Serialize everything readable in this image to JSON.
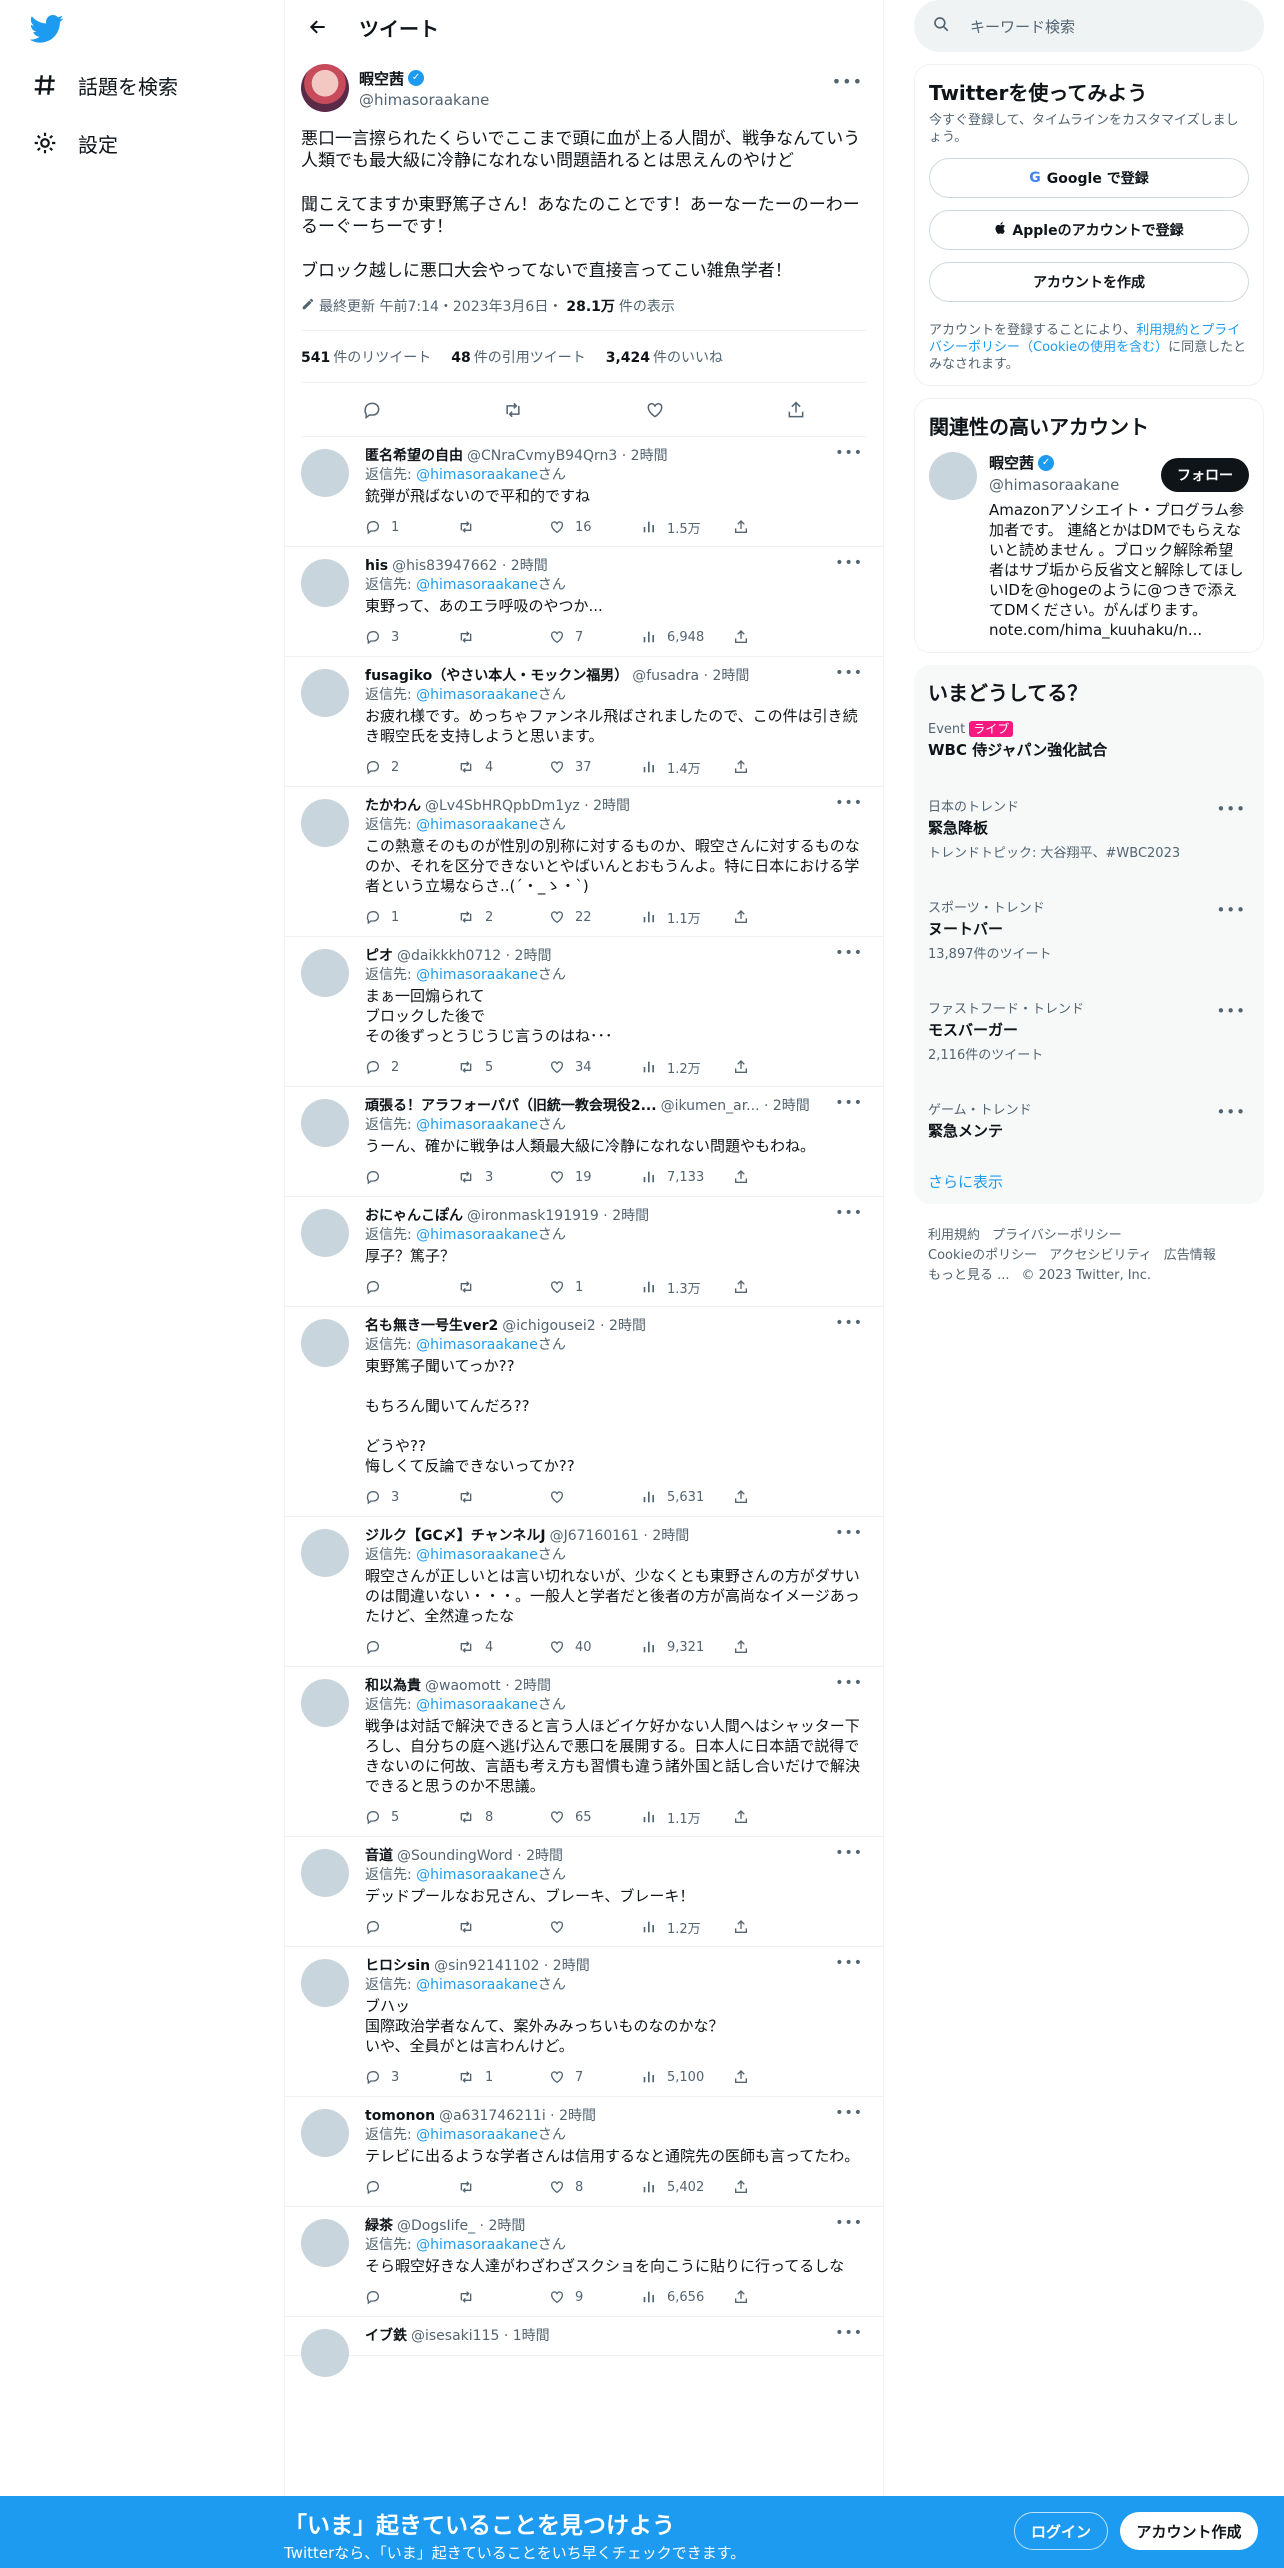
{
  "nav": {
    "explore_label": "話題を検索",
    "settings_label": "設定"
  },
  "header": {
    "title": "ツイート"
  },
  "main_tweet": {
    "name": "暇空茜",
    "handle": "@himasoraakane",
    "text": "悪口一言擦られたくらいでここまで頭に血が上る人間が、戦争なんていう人類でも最大級に冷静になれない問題語れるとは思えんのやけど\n\n聞こえてますか東野篤子さん！あなたのことです！あーなーたーのーわーるーぐーちーです！\n\nブロック越しに悪口大会やってないで直接言ってこい雑魚学者！",
    "edited": "最終更新 午前7:14・2023年3月6日・",
    "views": "28.1万",
    "views_label": "件の表示",
    "retweets": "541",
    "retweets_label": "件のリツイート",
    "quotes": "48",
    "quotes_label": "件の引用ツイート",
    "likes": "3,424",
    "likes_label": "件のいいね"
  },
  "reply_prefix": "返信先: ",
  "reply_to": "@himasoraakane",
  "reply_suffix": "さん",
  "replies": [
    {
      "name": "匿名希望の自由",
      "handle": "@CNraCvmyB94Qrn3",
      "time": "2時間",
      "text": "銃弾が飛ばないので平和的ですね",
      "replies": "1",
      "retweets": "",
      "likes": "16",
      "views": "1.5万"
    },
    {
      "name": "his",
      "handle": "@his83947662",
      "time": "2時間",
      "text": "東野って、あのエラ呼吸のやつか...",
      "replies": "3",
      "retweets": "",
      "likes": "7",
      "views": "6,948"
    },
    {
      "name": "fusagiko（やさい本人・モックン福男）",
      "handle": "@fusadra",
      "time": "2時間",
      "text": "お疲れ様です。めっちゃファンネル飛ばされましたので、この件は引き続き暇空氏を支持しようと思います。",
      "replies": "2",
      "retweets": "4",
      "likes": "37",
      "views": "1.4万"
    },
    {
      "name": "たかわん",
      "handle": "@Lv4SbHRQpbDm1yz",
      "time": "2時間",
      "text": "この熱意そのものが性別の別称に対するものか、暇空さんに対するものなのか、それを区分できないとやばいんとおもうんよ。特に日本における学者という立場ならさ..(´・_ゝ・`)",
      "replies": "1",
      "retweets": "2",
      "likes": "22",
      "views": "1.1万"
    },
    {
      "name": "ピオ",
      "handle": "@daikkkh0712",
      "time": "2時間",
      "text": "まぁ一回煽られて\nブロックした後で\nその後ずっとうじうじ言うのはね･･･",
      "replies": "2",
      "retweets": "5",
      "likes": "34",
      "views": "1.2万"
    },
    {
      "name": "頑張る！アラフォーパパ（旧統一教会現役2...",
      "handle": "@ikumen_ar...",
      "time": "2時間",
      "text": "うーん、確かに戦争は人類最大級に冷静になれない問題やもわね。",
      "replies": "",
      "retweets": "3",
      "likes": "19",
      "views": "7,133"
    },
    {
      "name": "おにゃんこぽん",
      "handle": "@ironmask191919",
      "time": "2時間",
      "text": "厚子？篤子？",
      "replies": "",
      "retweets": "",
      "likes": "1",
      "views": "1.3万"
    },
    {
      "name": "名も無き一号生ver2",
      "handle": "@ichigousei2",
      "time": "2時間",
      "text": "東野篤子聞いてっか??\n\nもちろん聞いてんだろ??\n\nどうや??\n悔しくて反論できないってか??",
      "replies": "3",
      "retweets": "",
      "likes": "",
      "views": "5,631"
    },
    {
      "name": "ジルク【GC〆】チャンネルJ",
      "handle": "@J67160161",
      "time": "2時間",
      "text": "暇空さんが正しいとは言い切れないが、少なくとも東野さんの方がダサいのは間違いない・・・。一般人と学者だと後者の方が高尚なイメージあったけど、全然違ったな",
      "replies": "",
      "retweets": "4",
      "likes": "40",
      "views": "9,321"
    },
    {
      "name": "和以為貴",
      "handle": "@waomott",
      "time": "2時間",
      "text": "戦争は対話で解決できると言う人ほどイケ好かない人間へはシャッター下ろし、自分ちの庭へ逃げ込んで悪口を展開する。日本人に日本語で説得できないのに何故、言語も考え方も習慣も違う諸外国と話し合いだけで解決できると思うのか不思議。",
      "replies": "5",
      "retweets": "8",
      "likes": "65",
      "views": "1.1万"
    },
    {
      "name": "音道",
      "handle": "@SoundingWord",
      "time": "2時間",
      "text": "デッドプールなお兄さん、ブレーキ、ブレーキ！",
      "replies": "",
      "retweets": "",
      "likes": "",
      "views": "1.2万"
    },
    {
      "name": "ヒロシsin",
      "handle": "@sin92141102",
      "time": "2時間",
      "text": "ブハッ\n国際政治学者なんて、案外みみっちいものなのかな？\nいや、全員がとは言わんけど。",
      "replies": "3",
      "retweets": "1",
      "likes": "7",
      "views": "5,100"
    },
    {
      "name": "tomonon",
      "handle": "@a631746211i",
      "time": "2時間",
      "text": "テレビに出るような学者さんは信用するなと通院先の医師も言ってたわ。",
      "replies": "",
      "retweets": "",
      "likes": "8",
      "views": "5,402"
    },
    {
      "name": "緑茶",
      "handle": "@DogsIife_",
      "time": "2時間",
      "text": "そら暇空好きな人達がわざわざスクショを向こうに貼りに行ってるしな",
      "replies": "",
      "retweets": "",
      "likes": "9",
      "views": "6,656"
    },
    {
      "name": "イブ鉄",
      "handle": "@isesaki115",
      "time": "1時間",
      "text": "",
      "replies": "",
      "retweets": "",
      "likes": "",
      "views": ""
    }
  ],
  "sidebar": {
    "search_placeholder": "キーワード検索",
    "signup": {
      "title": "Twitterを使ってみよう",
      "subtitle": "今すぐ登録して、タイムラインをカスタマイズしましょう。",
      "google": "Google で登録",
      "apple": "Appleのアカウントで登録",
      "create": "アカウントを作成",
      "terms_pre": "アカウントを登録することにより、",
      "terms_link": "利用規約とプライバシーポリシー（Cookieの使用を含む）",
      "terms_post": "に同意したとみなされます。"
    },
    "related": {
      "title": "関連性の高いアカウント",
      "name": "暇空茜",
      "handle": "@himasoraakane",
      "follow": "フォロー",
      "bio": "Amazonアソシエイト・プログラム参加者です。 連絡とかはDMでもらえないと読めません 。ブロック解除希望者はサブ垢から反省文と解除してほしいIDを@hogeのように@つきで添えてDMください。がんばります。note.com/hima_kuuhaku/n..."
    },
    "trends": {
      "title": "いまどうしてる？",
      "items": [
        {
          "category": "Event",
          "live": "ライブ",
          "title": "WBC 侍ジャパン強化試合",
          "extra": ""
        },
        {
          "category": "日本のトレンド",
          "live": "",
          "title": "緊急降板",
          "extra": "トレンドトピック: 大谷翔平、#WBC2023"
        },
        {
          "category": "スポーツ・トレンド",
          "live": "",
          "title": "ヌートバー",
          "extra": "13,897件のツイート"
        },
        {
          "category": "ファストフード・トレンド",
          "live": "",
          "title": "モスバーガー",
          "extra": "2,116件のツイート"
        },
        {
          "category": "ゲーム・トレンド",
          "live": "",
          "title": "緊急メンテ",
          "extra": ""
        }
      ],
      "show_more": "さらに表示"
    },
    "footer": [
      "利用規約",
      "プライバシーポリシー",
      "Cookieのポリシー",
      "アクセシビリティ",
      "広告情報",
      "もっと見る ...",
      "© 2023 Twitter, Inc."
    ]
  },
  "bottom": {
    "title": "「いま」起きていることを見つけよう",
    "subtitle": "Twitterなら、「いま」起きていることをいち早くチェックできます。",
    "login": "ログイン",
    "signup": "アカウント作成"
  }
}
